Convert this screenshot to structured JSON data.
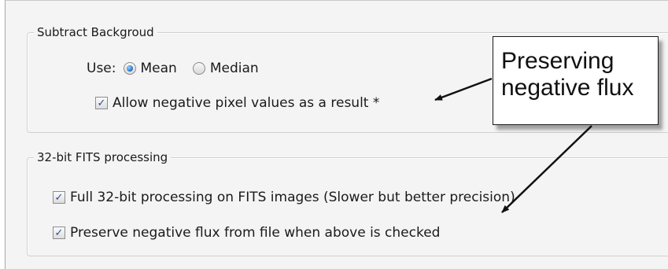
{
  "subtract_background": {
    "title": "Subtract Backgroud",
    "use_label": "Use:",
    "options": [
      {
        "label": "Mean",
        "selected": true
      },
      {
        "label": "Median",
        "selected": false
      }
    ],
    "allow_negative": {
      "label": "Allow negative pixel values as a result *",
      "checked": true
    }
  },
  "fits_processing": {
    "title": "32-bit FITS processing",
    "full_32bit": {
      "label": "Full 32-bit processing on FITS images (Slower but better precision)",
      "checked": true
    },
    "preserve_negative": {
      "label": "Preserve negative flux from file when above is checked",
      "checked": true
    }
  },
  "callout": {
    "line1": "Preserving",
    "line2": "negative flux"
  },
  "colors": {
    "panel_bg": "#f4f4f4",
    "radio_selected": "#1c6ec7",
    "check_mark": "#2a4d9a"
  }
}
